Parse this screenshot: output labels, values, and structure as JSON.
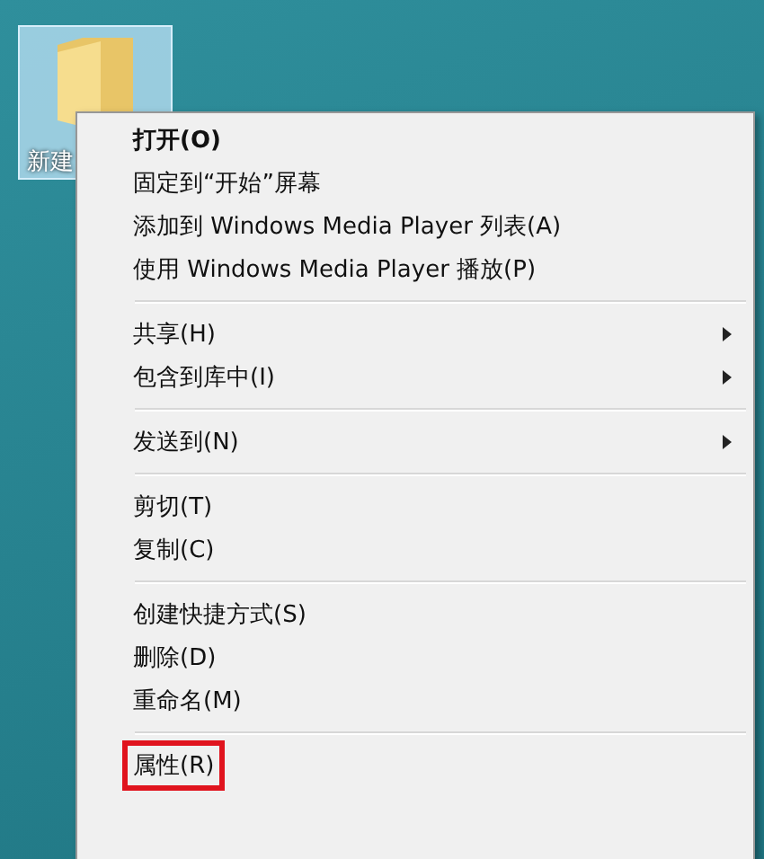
{
  "desktop_icon": {
    "label": "新建",
    "selected": true
  },
  "context_menu": {
    "items": [
      {
        "kind": "item",
        "label": "打开(O)",
        "default": true,
        "submenu": false,
        "highlighted": false
      },
      {
        "kind": "item",
        "label": "固定到“开始”屏幕",
        "default": false,
        "submenu": false,
        "highlighted": false
      },
      {
        "kind": "item",
        "label": "添加到 Windows Media Player 列表(A)",
        "default": false,
        "submenu": false,
        "highlighted": false
      },
      {
        "kind": "item",
        "label": "使用 Windows Media Player 播放(P)",
        "default": false,
        "submenu": false,
        "highlighted": false
      },
      {
        "kind": "separator"
      },
      {
        "kind": "item",
        "label": "共享(H)",
        "default": false,
        "submenu": true,
        "highlighted": false
      },
      {
        "kind": "item",
        "label": "包含到库中(I)",
        "default": false,
        "submenu": true,
        "highlighted": false
      },
      {
        "kind": "separator"
      },
      {
        "kind": "item",
        "label": "发送到(N)",
        "default": false,
        "submenu": true,
        "highlighted": false
      },
      {
        "kind": "separator"
      },
      {
        "kind": "item",
        "label": "剪切(T)",
        "default": false,
        "submenu": false,
        "highlighted": false
      },
      {
        "kind": "item",
        "label": "复制(C)",
        "default": false,
        "submenu": false,
        "highlighted": false
      },
      {
        "kind": "separator"
      },
      {
        "kind": "item",
        "label": "创建快捷方式(S)",
        "default": false,
        "submenu": false,
        "highlighted": false
      },
      {
        "kind": "item",
        "label": "删除(D)",
        "default": false,
        "submenu": false,
        "highlighted": false
      },
      {
        "kind": "item",
        "label": "重命名(M)",
        "default": false,
        "submenu": false,
        "highlighted": false
      },
      {
        "kind": "separator"
      },
      {
        "kind": "item",
        "label": "属性(R)",
        "default": false,
        "submenu": false,
        "highlighted": true
      }
    ]
  }
}
